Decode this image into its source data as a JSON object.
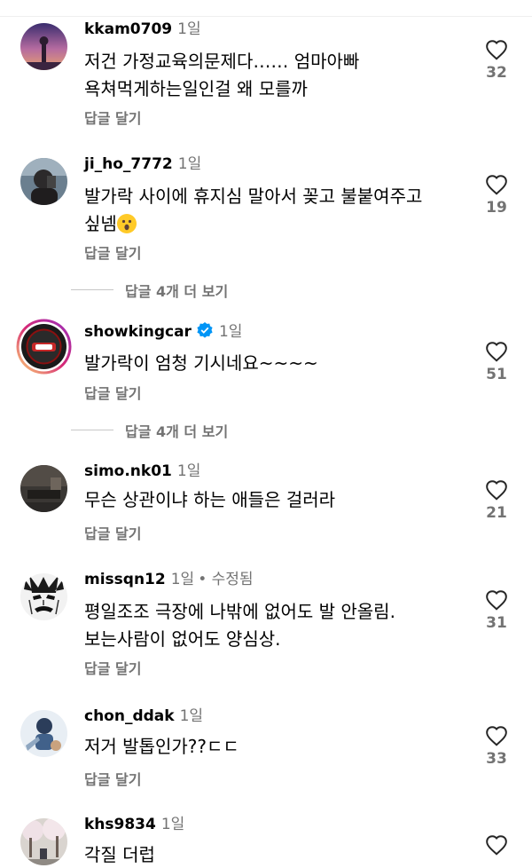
{
  "comments": [
    {
      "username": "kkam0709",
      "time": "1일",
      "lines": [
        "저건 가정교육의문제다…… 엄마아빠",
        "욕쳐먹게하는일인걸 왜 모를까"
      ],
      "reply_label": "답글 달기",
      "likes": "32",
      "avatar_icon": "sunset-avatar"
    },
    {
      "username": "ji_ho_7772",
      "time": "1일",
      "lines": [
        "발가락 사이에 휴지심 말아서 꽂고 불붙여주고",
        "싶넴"
      ],
      "emoji": "😮",
      "reply_label": "답글 달기",
      "likes": "19",
      "avatar_icon": "person-selfie-avatar"
    },
    {
      "username": "showkingcar",
      "time": "1일",
      "verified": true,
      "lines": [
        "발가락이 엄청 기시네요~~~~"
      ],
      "reply_label": "답글 달기",
      "likes": "51",
      "avatar_icon": "car-logo-avatar"
    },
    {
      "username": "simo.nk01",
      "time": "1일",
      "lines": [
        "무슨 상관이냐 하는 애들은 걸러라"
      ],
      "reply_label": "답글 달기",
      "likes": "21",
      "avatar_icon": "room-avatar"
    },
    {
      "username": "missqn12",
      "time": "1일",
      "edited": "• 수정됨",
      "lines": [
        "평일조조  극장에 나밖에 없어도 발 안올림.",
        "보는사람이 없어도 양심상."
      ],
      "reply_label": "답글 달기",
      "likes": "31",
      "avatar_icon": "manga-face-avatar"
    },
    {
      "username": "chon_ddak",
      "time": "1일",
      "lines": [
        "저거 발톱인가??ㄷㄷ"
      ],
      "reply_label": "답글 달기",
      "likes": "33",
      "avatar_icon": "cartoon-avatar"
    },
    {
      "username": "khs9834",
      "time": "1일",
      "lines": [
        "각질 더럽"
      ],
      "reply_label": "",
      "likes": "",
      "avatar_icon": "cherry-blossom-avatar"
    }
  ],
  "view_replies": [
    {
      "label": "답글 4개 더 보기"
    },
    {
      "label": "답글 4개 더 보기"
    }
  ],
  "colors": {
    "secondary_text": "#737373",
    "verified_blue": "#0095f6",
    "story_ring": [
      "#feda75",
      "#d62976",
      "#962fbf"
    ]
  }
}
